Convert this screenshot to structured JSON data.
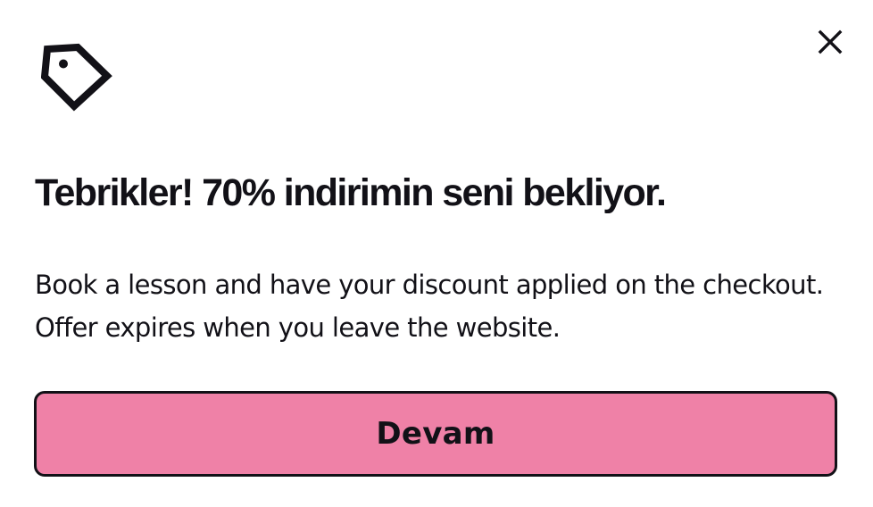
{
  "modal": {
    "icon": "price-tag-icon",
    "close_icon": "close-icon",
    "title": "Tebrikler! 70% indirimin seni bekliyor.",
    "description": "Book a lesson and have your discount applied on the checkout. Offer expires when you leave the website.",
    "continue_label": "Devam"
  },
  "colors": {
    "background": "#ffffff",
    "text": "#121117",
    "button_fill": "#ef81a7",
    "button_border": "#121117"
  }
}
